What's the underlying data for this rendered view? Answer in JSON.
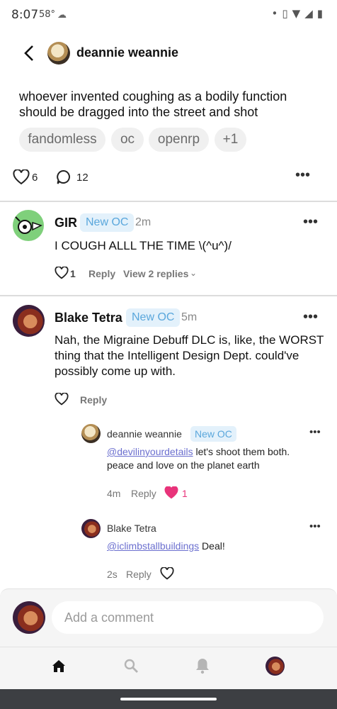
{
  "status": {
    "time": "8:07",
    "temp": "58°"
  },
  "post": {
    "author": "deannie weannie",
    "text": "whoever invented coughing as a bodily function should be dragged into the street and shot",
    "tags": [
      "fandomless",
      "oc",
      "openrp",
      "+1"
    ],
    "likes": "6",
    "comments": "12"
  },
  "comments": [
    {
      "user": "GIR",
      "badge": "New OC",
      "time": "2m",
      "text": "I COUGH ALLL THE TIME \\(^u^)/",
      "likes": "1",
      "reply": "Reply",
      "view_replies": "View 2 replies"
    },
    {
      "user": "Blake Tetra",
      "badge": "New OC",
      "time": "5m",
      "text": "Nah, the Migraine Debuff DLC is, like, the WORST thing that the Intelligent Design Dept. could've possibly come up with.",
      "reply": "Reply"
    }
  ],
  "replies": [
    {
      "user": "deannie weannie",
      "badge": "New OC",
      "mention": "@devilinyourdetails",
      "text": " let's shoot them both. peace and love on the planet earth",
      "time": "4m",
      "reply": "Reply",
      "likes": "1"
    },
    {
      "user": "Blake Tetra",
      "mention": "@iclimbstallbuildings",
      "text": " Deal!",
      "time": "2s",
      "reply": "Reply"
    }
  ],
  "composer": {
    "placeholder": "Add a comment"
  },
  "colors": {
    "accent_pink": "#e8337a",
    "badge_blue": "#5aa7dc",
    "mention": "#6b6fcf"
  }
}
